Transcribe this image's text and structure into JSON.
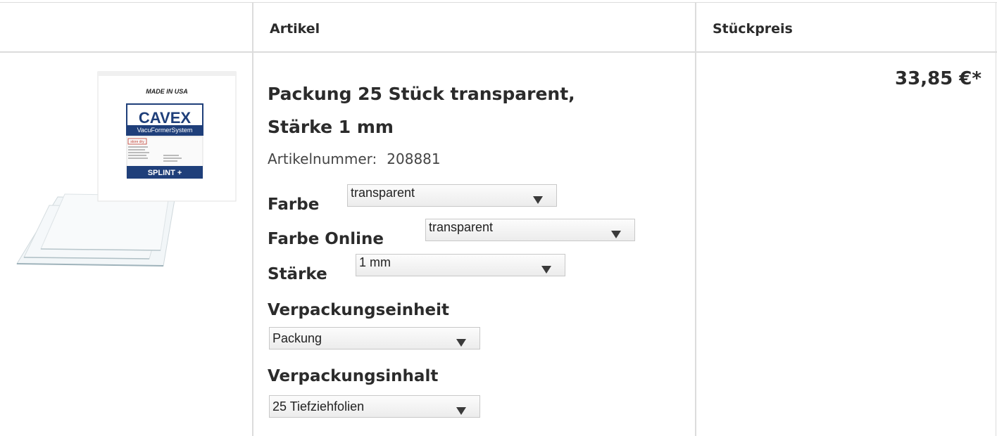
{
  "header": {
    "artikel": "Artikel",
    "stueckpreis": "Stückpreis"
  },
  "product": {
    "box_made_in": "MADE IN USA",
    "box_brand": "CAVEX",
    "box_system": "VacuFormerSystem",
    "box_store": "store dry",
    "box_name": "SPLINT +",
    "title_line1": "Packung 25 Stück transparent,",
    "title_line2": "Stärke 1 mm",
    "artnr_label": "Artikelnummer:",
    "artnr_value": "208881",
    "price": "33,85 €*"
  },
  "options": {
    "farbe": {
      "label": "Farbe",
      "value": "transparent"
    },
    "farbe_online": {
      "label": "Farbe Online",
      "value": "transparent"
    },
    "staerke": {
      "label": "Stärke",
      "value": "1 mm"
    },
    "verpackungseinheit": {
      "label": "Verpackungseinheit",
      "value": "Packung"
    },
    "verpackungsinhalt": {
      "label": "Verpackungsinhalt",
      "value": "25 Tiefziehfolien"
    }
  },
  "colors": {
    "box_blue": "#1f3f7a",
    "border": "#dcdcdc"
  }
}
